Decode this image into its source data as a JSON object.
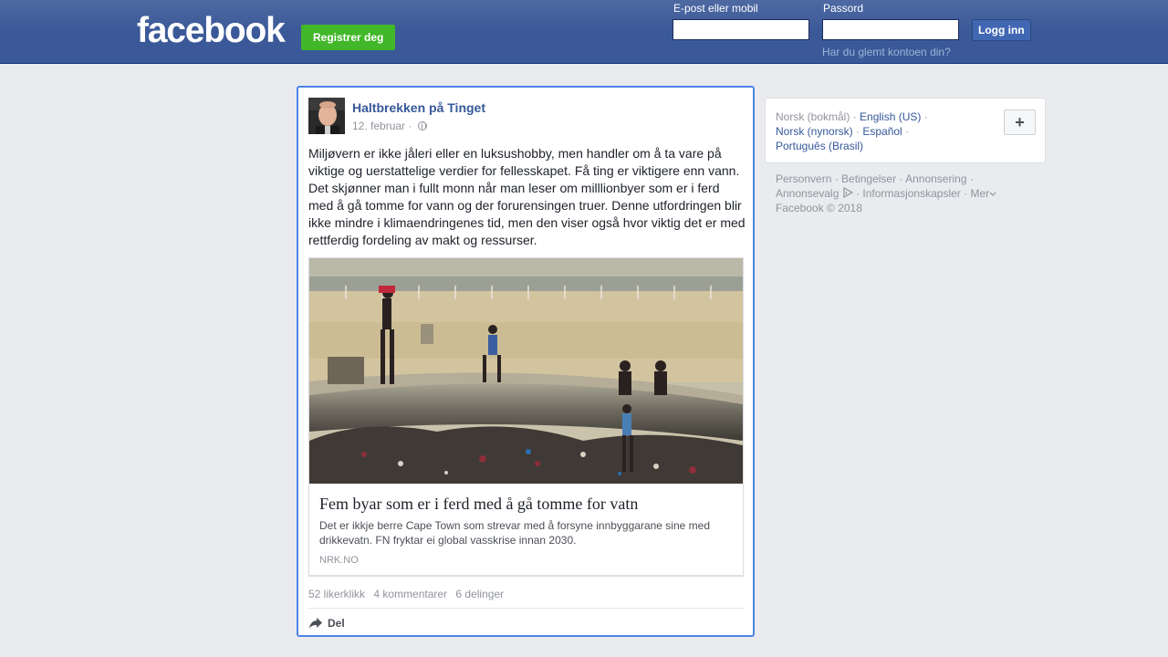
{
  "header": {
    "logo": "facebook",
    "register_label": "Registrer deg",
    "email_label": "E-post eller mobil",
    "password_label": "Passord",
    "login_label": "Logg inn",
    "forgot_label": "Har du glemt kontoen din?",
    "email_value": "",
    "password_value": ""
  },
  "post": {
    "author": "Haltbrekken på Tinget",
    "date": "12. februar",
    "date_sep": " · ",
    "privacy_icon": "globe-icon",
    "text": "Miljøvern er ikke jåleri eller en luksushobby, men handler om å ta vare på viktige og uerstattelige verdier for fellesskapet. Få ting er viktigere enn vann. Det skjønner man i fullt monn når man leser om milllionbyer som er i ferd med å gå tomme for vann og der forurensingen truer. Denne utfordringen blir ikke mindre i klimaendringenes tid, men den viser også hvor viktig det er med rettferdig fordeling av makt og ressurser.",
    "link": {
      "title": "Fem byar som er i ferd med å gå tomme for vatn",
      "description": "Det er ikkje berre Cape Town som strevar med å forsyne innbyggarane sine med drikkevatn. FN fryktar ei global vasskrise innan 2030.",
      "domain": "NRK.NO"
    },
    "likes": "52 likerklikk",
    "comments": "4 kommentarer",
    "shares": "6 delinger",
    "share_label": "Del"
  },
  "sidebar": {
    "current_language": "Norsk (bokmål)",
    "languages": [
      "English (US)",
      "Norsk (nynorsk)",
      "Español",
      "Português (Brasil)"
    ],
    "plus_label": "+",
    "sep": " · ",
    "footer": {
      "privacy": "Personvern",
      "terms": "Betingelser",
      "advertising": "Annonsering",
      "ad_choices": "Annonsevalg",
      "cookies": "Informasjonskapsler",
      "more": "Mer",
      "copyright": "Facebook © 2018"
    }
  },
  "colors": {
    "brand": "#3b5998",
    "register_green": "#42b72a",
    "link_blue": "#365899",
    "focus_border": "#4c84e6"
  }
}
